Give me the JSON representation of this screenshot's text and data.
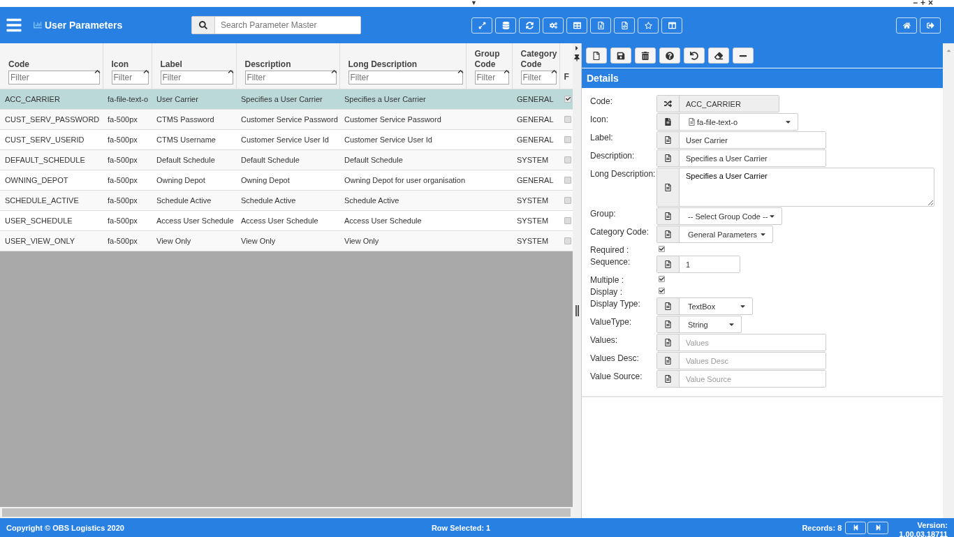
{
  "top_strip": {
    "toggle": "▼",
    "window_controls": [
      "−",
      "+",
      "×"
    ]
  },
  "header": {
    "title": "User Parameters",
    "search": {
      "placeholder": "Search Parameter Master"
    }
  },
  "table": {
    "columns": [
      {
        "label": "Code",
        "placeholder": "Filter"
      },
      {
        "label": "Icon",
        "placeholder": "Filter"
      },
      {
        "label": "Label",
        "placeholder": "Filter"
      },
      {
        "label": "Description",
        "placeholder": "Filter"
      },
      {
        "label": "Long Description",
        "placeholder": "Filter"
      },
      {
        "label": "Group Code",
        "placeholder": "Filter"
      },
      {
        "label": "Category Code",
        "placeholder": "Filter"
      },
      {
        "label": "F"
      }
    ],
    "rows": [
      {
        "cells": [
          "ACC_CARRIER",
          "fa-file-text-o",
          "User Carrier",
          "Specifies a User Carrier",
          "Specifies a User Carrier",
          "",
          "GENERAL"
        ],
        "checked": true,
        "selected": true
      },
      {
        "cells": [
          "CUST_SERV_PASSWORD",
          "fa-500px",
          "CTMS Password",
          "Customer Service Password",
          "Customer Service Password",
          "",
          "GENERAL"
        ],
        "checked": false,
        "selected": false
      },
      {
        "cells": [
          "CUST_SERV_USERID",
          "fa-500px",
          "CTMS Username",
          "Customer Service User Id",
          "Customer Service User Id",
          "",
          "GENERAL"
        ],
        "checked": false,
        "selected": false
      },
      {
        "cells": [
          "DEFAULT_SCHEDULE",
          "fa-500px",
          "Default Schedule",
          "Default Schedule",
          "Default Schedule",
          "",
          "SYSTEM"
        ],
        "checked": false,
        "selected": false
      },
      {
        "cells": [
          "OWNING_DEPOT",
          "fa-500px",
          "Owning Depot",
          "Owning Depot",
          "Owning Depot for user organisation",
          "",
          "GENERAL"
        ],
        "checked": false,
        "selected": false
      },
      {
        "cells": [
          "SCHEDULE_ACTIVE",
          "fa-500px",
          "Schedule Active",
          "Schedule Active",
          "Schedule Active",
          "",
          "SYSTEM"
        ],
        "checked": false,
        "selected": false
      },
      {
        "cells": [
          "USER_SCHEDULE",
          "fa-500px",
          "Access User Schedule",
          "Access User Schedule",
          "Access User Schedule",
          "",
          "SYSTEM"
        ],
        "checked": false,
        "selected": false
      },
      {
        "cells": [
          "USER_VIEW_ONLY",
          "fa-500px",
          "View Only",
          "View Only",
          "View Only",
          "",
          "SYSTEM"
        ],
        "checked": false,
        "selected": false
      }
    ]
  },
  "details": {
    "title": "Details",
    "fields": [
      {
        "kind": "code",
        "label": "Code:",
        "value": "ACC_CARRIER"
      },
      {
        "kind": "icon",
        "label": "Icon:",
        "value": "fa-file-text-o"
      },
      {
        "kind": "text",
        "label": "Label:",
        "value": "User Carrier"
      },
      {
        "kind": "text",
        "label": "Description:",
        "value": "Specifies a User Carrier"
      },
      {
        "kind": "textarea",
        "label": "Long Description:",
        "value": "Specifies a User Carrier"
      },
      {
        "kind": "select",
        "label": "Group:",
        "value": "-- Select Group Code --"
      },
      {
        "kind": "select",
        "label": "Category Code:",
        "value": "General Parameters"
      },
      {
        "kind": "checkbox",
        "label": "Required :",
        "checked": true
      },
      {
        "kind": "text",
        "label": "Sequence:",
        "value": "1"
      },
      {
        "kind": "checkbox",
        "label": "Multiple :",
        "checked": true
      },
      {
        "kind": "checkbox",
        "label": "Display :",
        "checked": true
      },
      {
        "kind": "select",
        "label": "Display Type:",
        "value": "TextBox"
      },
      {
        "kind": "select",
        "label": "ValueType:",
        "value": "String"
      },
      {
        "kind": "text",
        "label": "Values:",
        "placeholder": "Values"
      },
      {
        "kind": "text",
        "label": "Values Desc:",
        "placeholder": "Values Desc"
      },
      {
        "kind": "text",
        "label": "Value Source:",
        "placeholder": "Value Source"
      }
    ]
  },
  "footer": {
    "copyright": "Copyright © OBS Logistics 2020",
    "row_selected": "Row Selected: 1",
    "records": "Records: 8",
    "version_label": "Version:",
    "version": "1.00.03.18711"
  }
}
